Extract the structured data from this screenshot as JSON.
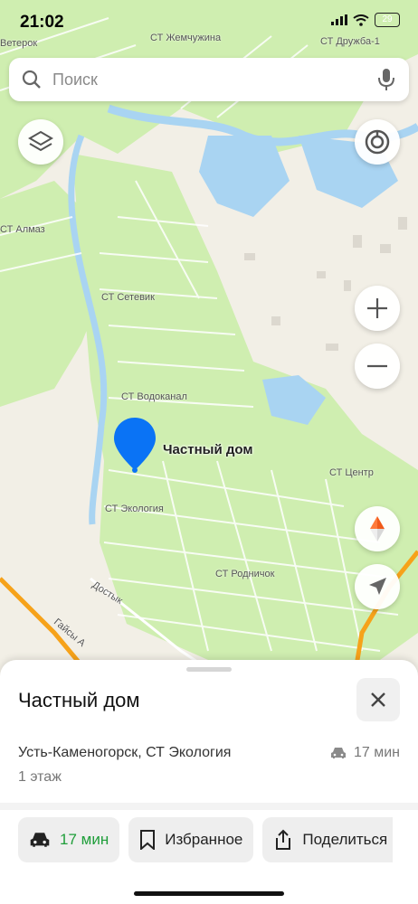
{
  "status_bar": {
    "time": "21:02",
    "battery": "29"
  },
  "search": {
    "placeholder": "Поиск"
  },
  "map": {
    "pin_label": "Частный дом",
    "labels": [
      "СТ Жемчужина",
      "СТ Дружба-1",
      "Ветерок",
      "СТ Алмаз",
      "СТ Сетевик",
      "СТ Водоканал",
      "СТ Центр",
      "СТ Экология",
      "СТ Родничок",
      "Достык",
      "Гайсы А"
    ],
    "colors": {
      "land": "#f2efe6",
      "green": "#cfeeb0",
      "water": "#a9d4f2",
      "road": "#f6a21a",
      "pin": "#0a73f5"
    }
  },
  "controls": {
    "layers": "layers-icon",
    "compass": "compass-icon",
    "zoom_in": "plus-icon",
    "zoom_out": "minus-icon",
    "north": "north-arrow-icon",
    "locate": "location-arrow-icon"
  },
  "sheet": {
    "title": "Частный дом",
    "address": "Усть-Каменогорск, СТ Экология",
    "eta": "17 мин",
    "floor": "1 этаж",
    "actions": [
      {
        "label": "17 мин",
        "icon": "car-icon",
        "color": "#1f9e3a"
      },
      {
        "label": "Избранное",
        "icon": "bookmark-icon"
      },
      {
        "label": "Поделиться",
        "icon": "share-icon"
      }
    ]
  }
}
